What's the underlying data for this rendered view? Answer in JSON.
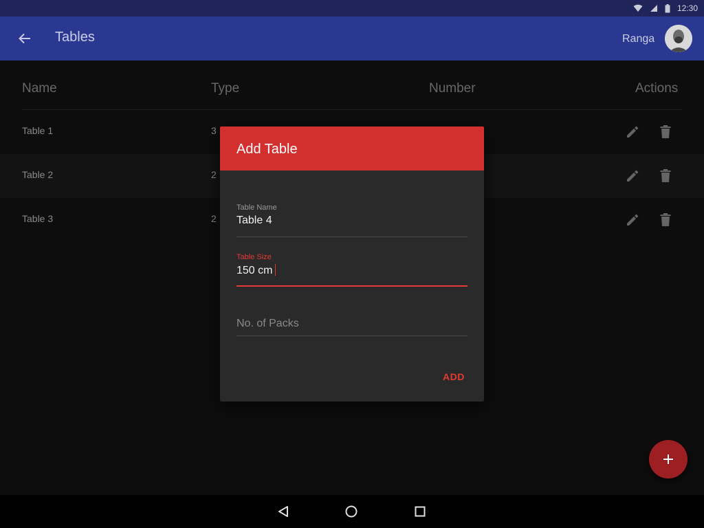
{
  "status_bar": {
    "time": "12:30",
    "icons": [
      "wifi-icon",
      "signal-icon",
      "battery-icon"
    ]
  },
  "app_bar": {
    "title": "Tables",
    "user_name": "Ranga",
    "back_icon": "arrow-back-icon"
  },
  "table": {
    "headers": {
      "name": "Name",
      "type": "Type",
      "number": "Number",
      "actions": "Actions"
    },
    "rows": [
      {
        "name": "Table 1",
        "type": "3 :"
      },
      {
        "name": "Table 2",
        "type": "2 :"
      },
      {
        "name": "Table 3",
        "type": "2 :"
      }
    ],
    "row_actions": [
      "edit-icon",
      "delete-icon"
    ]
  },
  "dialog": {
    "title": "Add Table",
    "fields": {
      "table_name": {
        "label": "Table Name",
        "value": "Table 4"
      },
      "table_size": {
        "label": "Table Size",
        "value": "150 cm"
      },
      "packs": {
        "placeholder": "No. of Packs"
      }
    },
    "add_label": "ADD"
  },
  "fab": {
    "icon": "plus-icon"
  },
  "colors": {
    "primary": "#2b3891",
    "status_bar": "#1f2559",
    "accent": "#d32f2f",
    "fab": "#9e1f22",
    "background": "#121212"
  },
  "nav_bar": {
    "buttons": [
      "back-triangle-icon",
      "home-circle-icon",
      "recents-square-icon"
    ]
  }
}
